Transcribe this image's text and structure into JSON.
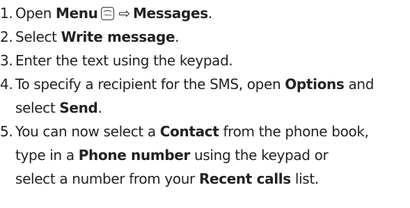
{
  "steps": [
    {
      "number": "1.",
      "open_prefix": "Open ",
      "menu_label": "Menu",
      "menu_icon": "menu-key-icon",
      "arrow": "⇨",
      "messages_label": "Messages",
      "end": "."
    },
    {
      "number": "2.",
      "prefix": "Select ",
      "bold": "Write message",
      "end": "."
    },
    {
      "number": "3.",
      "text": "Enter the text using the keypad."
    },
    {
      "number": "4.",
      "line1_prefix": "To specify a recipient for the SMS, open ",
      "options_label": "Options",
      "line1_suffix": " and",
      "line2_prefix": "select ",
      "send_label": "Send",
      "end": "."
    },
    {
      "number": "5.",
      "line1_prefix": "You can now select a ",
      "contact_label": "Contact",
      "line1_suffix": " from the phone book,",
      "line2_prefix": "type in a ",
      "phone_label": "Phone number",
      "line2_suffix": " using the keypad or",
      "line3_prefix": "select a number from your ",
      "recent_label": "Recent calls",
      "line3_suffix": " list."
    }
  ]
}
